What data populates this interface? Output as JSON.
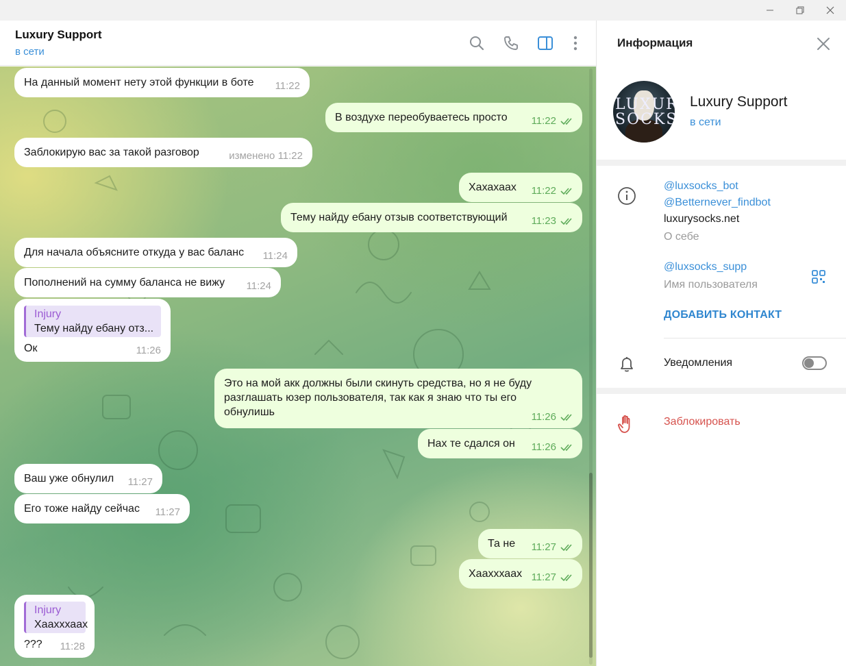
{
  "window": {
    "minimize_icon": "minimize-icon",
    "maximize_icon": "restore-icon",
    "close_icon": "close-icon"
  },
  "chat": {
    "title": "Luxury Support",
    "status": "в сети",
    "header_icons": [
      "search-icon",
      "phone-icon",
      "sidebar-toggle-icon",
      "more-vertical-icon"
    ],
    "accent_color": "#3a8fd8",
    "messages": [
      {
        "dir": "in",
        "text": "На данный момент нету этой функции в боте",
        "time": "11:22"
      },
      {
        "dir": "out",
        "text": "В воздухе переобуваетесь просто",
        "time": "11:22",
        "read": true
      },
      {
        "dir": "in",
        "text": "Заблокирую вас за такой разговор",
        "time": "изменено 11:22"
      },
      {
        "dir": "out",
        "text": "Хахахаах",
        "time": "11:22",
        "read": true
      },
      {
        "dir": "out",
        "text": "Тему найду ебану отзыв соответствующий",
        "time": "11:23",
        "read": true
      },
      {
        "dir": "in",
        "text": "Для начала объясните откуда у вас баланс",
        "time": "11:24"
      },
      {
        "dir": "in",
        "text": "Пополнений на сумму баланса не вижу",
        "time": "11:24"
      },
      {
        "dir": "in",
        "reply_name": "Injury",
        "reply_text": "Тему найду ебану отз...",
        "text": "Ок",
        "time": "11:26"
      },
      {
        "dir": "out",
        "text": "Это на мой акк должны были скинуть средства, но я не буду разглашать юзер пользователя, так как я знаю что ты его обнулишь",
        "time": "11:26",
        "read": true
      },
      {
        "dir": "out",
        "text": "Нах те сдался он",
        "time": "11:26",
        "read": true
      },
      {
        "dir": "in",
        "text": "Ваш уже обнулил",
        "time": "11:27"
      },
      {
        "dir": "in",
        "text": "Его тоже найду сейчас",
        "time": "11:27"
      },
      {
        "dir": "out",
        "text": "Та не",
        "time": "11:27",
        "read": true
      },
      {
        "dir": "out",
        "text": "Хаахххаах",
        "time": "11:27",
        "read": true
      },
      {
        "dir": "in",
        "reply_name": "Injury",
        "reply_text": "Хаахххаах",
        "text": "???",
        "time": "11:28"
      }
    ]
  },
  "info": {
    "title": "Информация",
    "close_icon": "close-icon",
    "profile_name": "Luxury Support",
    "profile_status": "в сети",
    "avatar_text_line1": "LUXURY",
    "avatar_text_line2": "SOCKS",
    "bio_links": [
      "@luxsocks_bot",
      "@Betternever_findbot"
    ],
    "bio_site": "luxurysocks.net",
    "bio_label": "О себе",
    "username": "@luxsocks_supp",
    "username_label": "Имя пользователя",
    "add_contact": "ДОБАВИТЬ КОНТАКТ",
    "notifications_label": "Уведомления",
    "notifications_on": false,
    "block_label": "Заблокировать",
    "block_color": "#d6524d"
  }
}
